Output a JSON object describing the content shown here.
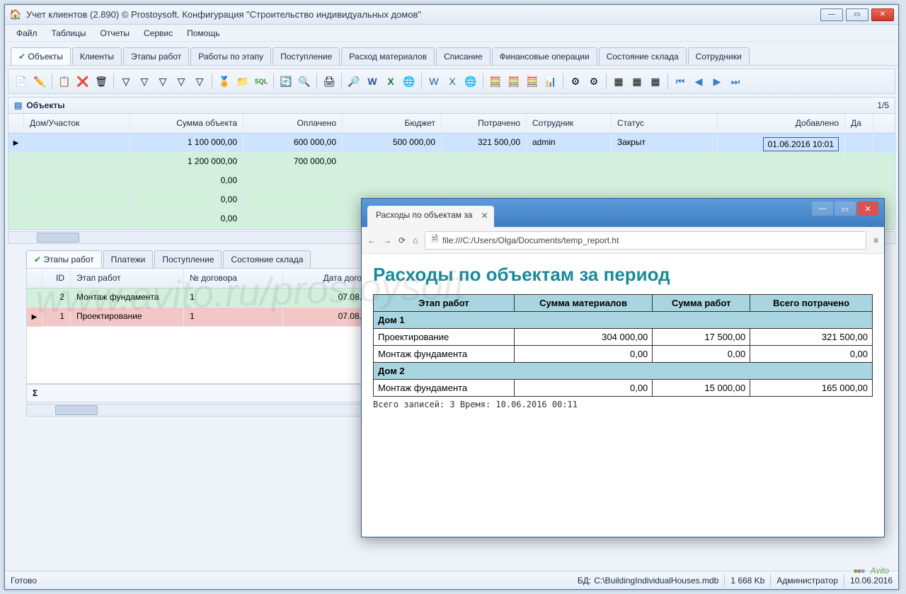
{
  "window": {
    "title": "Учет клиентов (2.890) © Prostoysoft. Конфигурация \"Строительство индивидуальных домов\"",
    "icon": "🏠"
  },
  "menu": [
    "Файл",
    "Таблицы",
    "Отчеты",
    "Сервис",
    "Помощь"
  ],
  "main_tabs": [
    "Объекты",
    "Клиенты",
    "Этапы работ",
    "Работы по этапу",
    "Поступление",
    "Расход материалов",
    "Списание",
    "Финансовые операции",
    "Состояние склада",
    "Сотрудники"
  ],
  "section": {
    "title": "Объекты",
    "counter": "1/5",
    "icon": "▤"
  },
  "grid": {
    "columns": [
      "Дом/Участок",
      "Сумма объекта",
      "Оплачено",
      "Бюджет",
      "Потрачено",
      "Сотрудник",
      "Статус",
      "Добавлено",
      "Да"
    ],
    "rows": [
      {
        "house": "",
        "sum": "1 100 000,00",
        "paid": "600 000,00",
        "budget": "500 000,00",
        "spent": "321 500,00",
        "emp": "admin",
        "status": "Закрыт",
        "added": "01.06.2016 10:01",
        "sel": true
      },
      {
        "house": "",
        "sum": "1 200 000,00",
        "paid": "700 000,00",
        "budget": "",
        "spent": "",
        "emp": "",
        "status": "",
        "added": "",
        "alt": true
      },
      {
        "house": "",
        "sum": "0,00",
        "paid": "",
        "budget": "",
        "spent": "",
        "emp": "",
        "status": "",
        "added": "",
        "alt": true
      },
      {
        "house": "",
        "sum": "0,00",
        "paid": "",
        "budget": "",
        "spent": "",
        "emp": "",
        "status": "",
        "added": "",
        "alt": true
      },
      {
        "house": "",
        "sum": "0,00",
        "paid": "",
        "budget": "",
        "spent": "",
        "emp": "",
        "status": "",
        "added": "",
        "alt": true
      }
    ]
  },
  "sub_tabs": [
    "Этапы работ",
    "Платежи",
    "Поступление",
    "Состояние склада"
  ],
  "sub_grid": {
    "columns": [
      "ID",
      "Этап работ",
      "№ договора",
      "Дата дого"
    ],
    "rows": [
      {
        "id": "2",
        "stage": "Монтаж фундамента",
        "contract": "1",
        "date": "07.08.",
        "cls": "alt"
      },
      {
        "id": "1",
        "stage": "Проектирование",
        "contract": "1",
        "date": "07.08.",
        "cls": "pink",
        "sel": true
      }
    ]
  },
  "sigma": "Σ",
  "status": {
    "ready": "Готово",
    "db_lbl": "БД:",
    "db": "C:\\BuildingIndividualHouses.mdb",
    "size": "1 668 Kb",
    "user": "Администратор",
    "date": "10.06.2016"
  },
  "browser": {
    "tab": "Расходы по объектам за",
    "url": "file:///C:/Users/Olga/Documents/temp_report.ht",
    "h1": "Расходы по объектам за период",
    "th": [
      "Этап работ",
      "Сумма материалов",
      "Сумма работ",
      "Всего потрачено"
    ],
    "groups": [
      {
        "name": "Дом 1",
        "rows": [
          {
            "stage": "Проектирование",
            "mat": "304 000,00",
            "work": "17 500,00",
            "total": "321 500,00"
          },
          {
            "stage": "Монтаж фундамента",
            "mat": "0,00",
            "work": "0,00",
            "total": "0,00"
          }
        ]
      },
      {
        "name": "Дом 2",
        "rows": [
          {
            "stage": "Монтаж фундамента",
            "mat": "0,00",
            "work": "15 000,00",
            "total": "165 000,00"
          }
        ]
      }
    ],
    "footer": "Всего записей: 3   Время: 10.06.2016 00:11"
  },
  "watermark": "www.avito.ru/prostoysoft",
  "avito": "Avito"
}
